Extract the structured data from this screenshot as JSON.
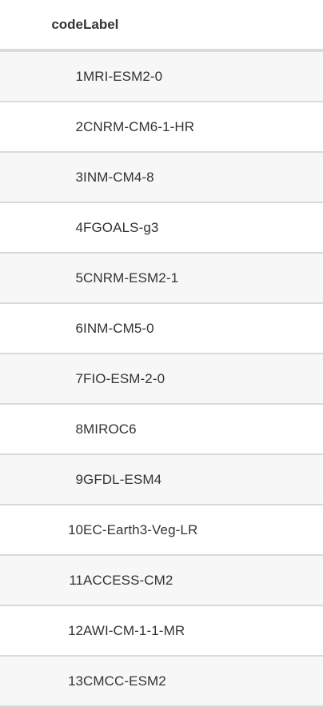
{
  "table": {
    "headers": {
      "code": "code",
      "label": "Label"
    },
    "rows": [
      {
        "code": "1",
        "label": "MRI-ESM2-0"
      },
      {
        "code": "2",
        "label": "CNRM-CM6-1-HR"
      },
      {
        "code": "3",
        "label": "INM-CM4-8"
      },
      {
        "code": "4",
        "label": "FGOALS-g3"
      },
      {
        "code": "5",
        "label": "CNRM-ESM2-1"
      },
      {
        "code": "6",
        "label": "INM-CM5-0"
      },
      {
        "code": "7",
        "label": "FIO-ESM-2-0"
      },
      {
        "code": "8",
        "label": "MIROC6"
      },
      {
        "code": "9",
        "label": "GFDL-ESM4"
      },
      {
        "code": "10",
        "label": "EC-Earth3-Veg-LR"
      },
      {
        "code": "11",
        "label": "ACCESS-CM2"
      },
      {
        "code": "12",
        "label": "AWI-CM-1-1-MR"
      },
      {
        "code": "13",
        "label": "CMCC-ESM2"
      }
    ]
  }
}
